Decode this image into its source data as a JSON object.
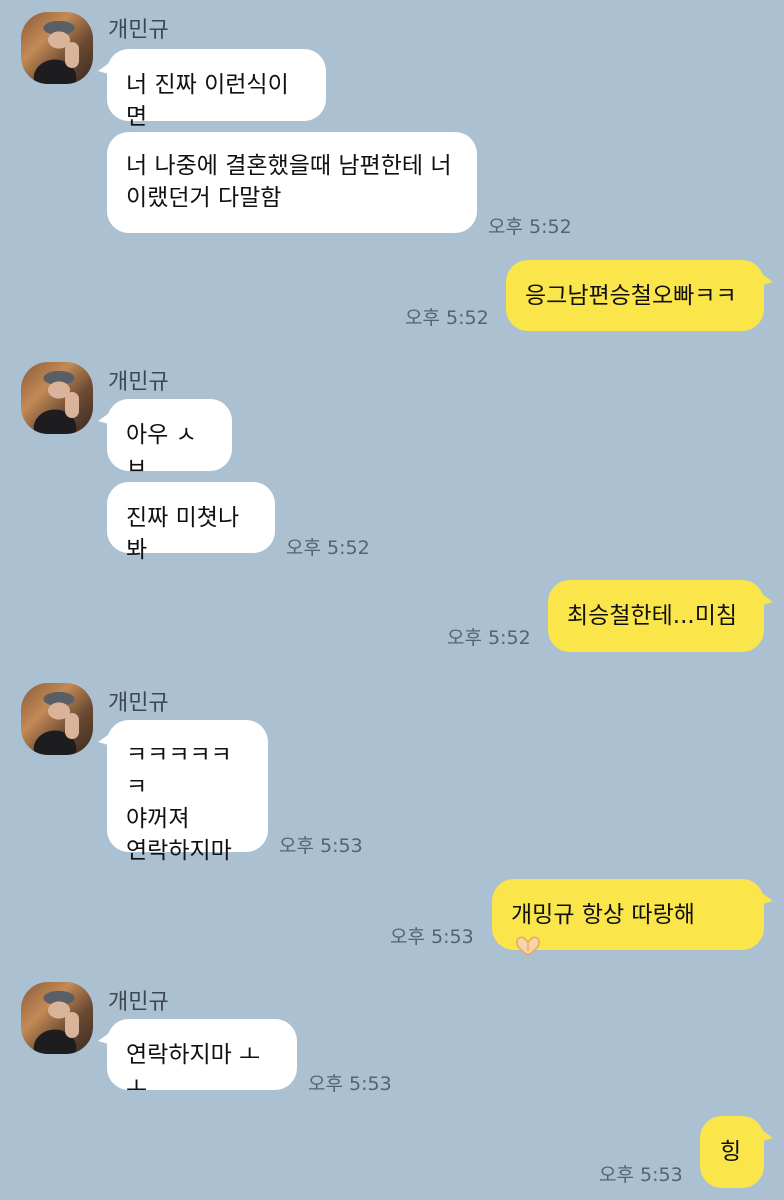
{
  "chat": {
    "sender": "개민규",
    "time_label": "오후 5:52",
    "messages": [
      {
        "from": "other",
        "text": "너 진짜 이런식이면"
      },
      {
        "from": "other",
        "text": "너 나중에 결혼했을때 남편한테 너\n이랬던거 다말함",
        "time": "오후 5:52"
      },
      {
        "from": "me",
        "text": "응그남편승철오빠ㅋㅋ",
        "time": "오후 5:52"
      },
      {
        "from": "other",
        "text": "아우 ㅅㅂ"
      },
      {
        "from": "other",
        "text": "진짜 미쳣나봐",
        "time": "오후 5:52"
      },
      {
        "from": "me",
        "text": "최승철한테...미침",
        "time": "오후 5:52"
      },
      {
        "from": "other",
        "text": "ㅋㅋㅋㅋㅋㅋ\n야꺼져\n연락하지마",
        "time": "오후 5:53"
      },
      {
        "from": "me",
        "text": "개밍규 항상 따랑해",
        "emoji": "heart-hands-emoji",
        "time": "오후 5:53"
      },
      {
        "from": "other",
        "text": "연락하지마 ㅗㅗ",
        "time": "오후 5:53"
      },
      {
        "from": "me",
        "text": "힝",
        "time": "오후 5:53"
      }
    ]
  },
  "colors": {
    "background": "#abc1d1",
    "my_bubble": "#fae54b",
    "their_bubble": "#ffffff"
  }
}
